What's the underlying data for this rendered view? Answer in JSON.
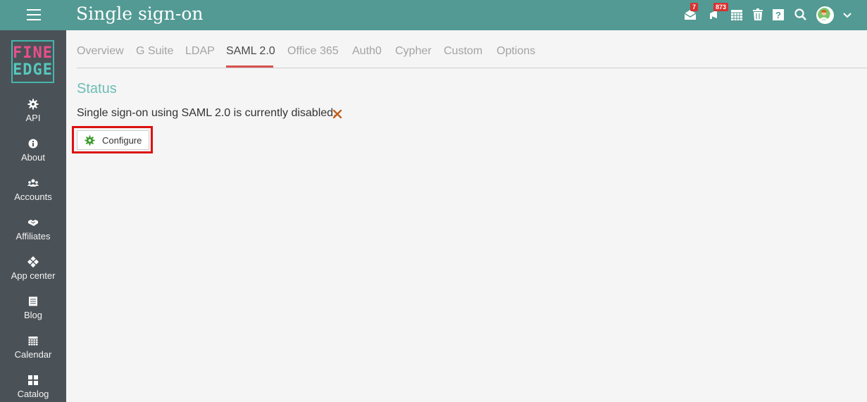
{
  "header": {
    "title": "Single sign-on",
    "menu_icon": "hamburger-icon",
    "icons": [
      {
        "name": "mail-icon",
        "badge": "7"
      },
      {
        "name": "notifications-icon",
        "badge": "873"
      },
      {
        "name": "calendar-grid-icon"
      },
      {
        "name": "trash-icon"
      },
      {
        "name": "help-icon"
      },
      {
        "name": "search-icon"
      }
    ],
    "avatar": "user-avatar",
    "dropdown_icon": "chevron-down-icon"
  },
  "logo": {
    "line1": "FINE",
    "line2": "EDGE"
  },
  "sidebar": {
    "items": [
      {
        "label": "API",
        "icon": "gear-icon"
      },
      {
        "label": "About",
        "icon": "info-icon"
      },
      {
        "label": "Accounts",
        "icon": "users-icon"
      },
      {
        "label": "Affiliates",
        "icon": "handshake-icon"
      },
      {
        "label": "App center",
        "icon": "diamond-grid-icon"
      },
      {
        "label": "Blog",
        "icon": "blog-icon"
      },
      {
        "label": "Calendar",
        "icon": "calendar-icon"
      },
      {
        "label": "Catalog",
        "icon": "catalog-grid-icon"
      }
    ]
  },
  "tabs": [
    {
      "label": "Overview"
    },
    {
      "label": "G Suite"
    },
    {
      "label": "LDAP"
    },
    {
      "label": "SAML 2.0",
      "active": true
    },
    {
      "label": "Office 365"
    },
    {
      "label": "Auth0"
    },
    {
      "label": "Cypher"
    },
    {
      "label": "Custom"
    },
    {
      "label": "Options"
    }
  ],
  "main": {
    "section_title": "Status",
    "status_text": "Single sign-on using SAML 2.0 is currently disabled.",
    "status_icon": "close-icon",
    "configure_label": "Configure",
    "configure_icon": "gear-icon"
  },
  "colors": {
    "header": "#539a94",
    "sidebar": "#4b5257",
    "accent": "#6cbdb6",
    "active_tab_underline": "#d9534f",
    "badge": "#d9302f",
    "disabled_x": "#c0601d",
    "gear_green": "#3a9a2a"
  }
}
